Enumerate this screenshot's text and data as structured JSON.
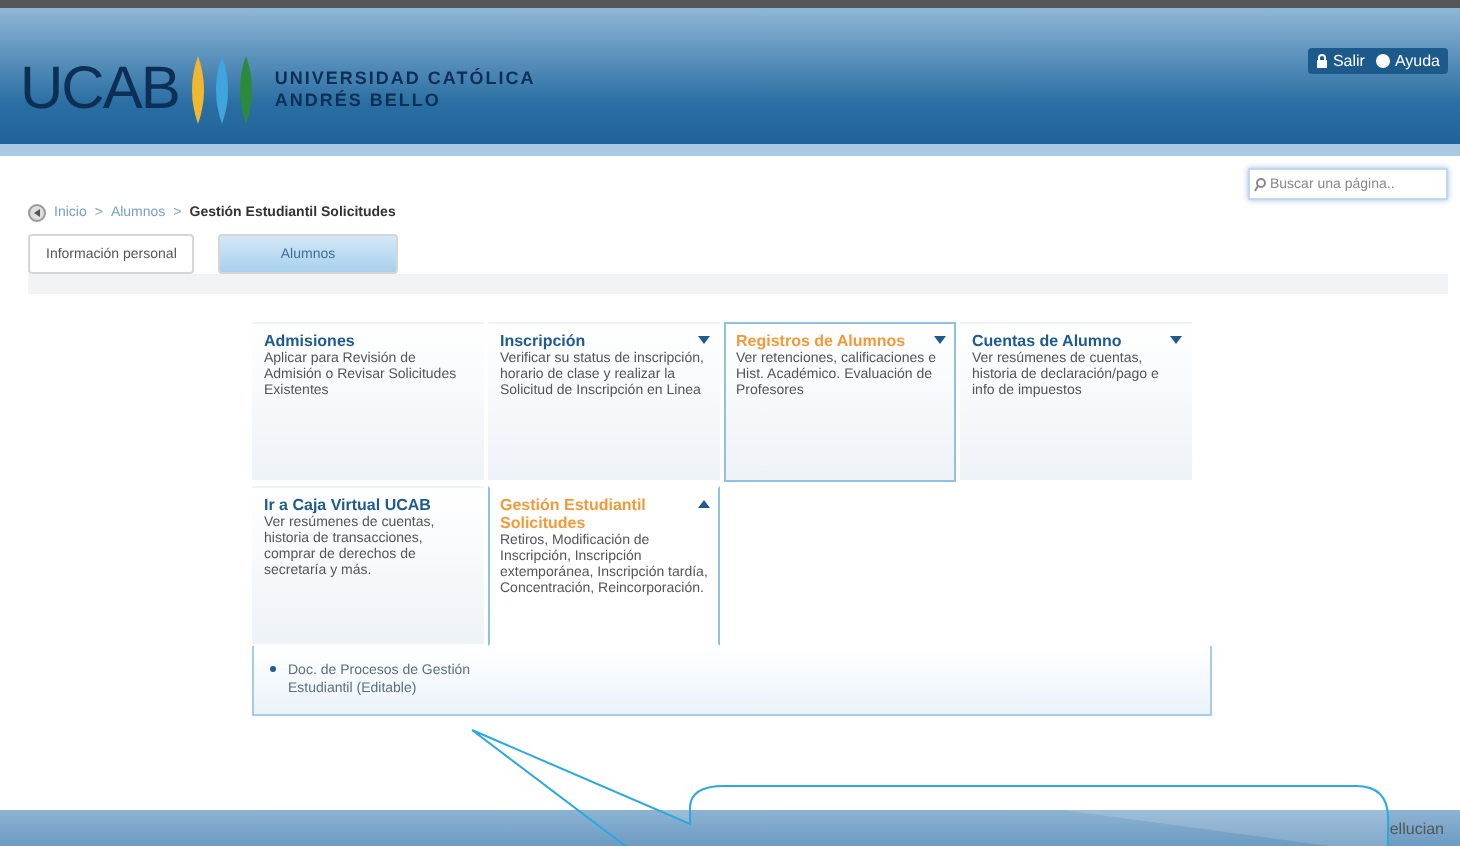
{
  "header": {
    "logo": "UCAB",
    "university_line_1": "UNIVERSIDAD CATÓLICA",
    "university_line_2": "ANDRÉS BELLO",
    "buttons": [
      "Salir",
      "Ayuda"
    ]
  },
  "search": {
    "placeholder": "Buscar una página.."
  },
  "breadcrumb": {
    "links": [
      "Inicio",
      "Alumnos"
    ],
    "separator": ">",
    "current": "Gestión Estudiantil Solicitudes"
  },
  "tabs": [
    {
      "label": "Información personal",
      "selected": false
    },
    {
      "label": "Alumnos",
      "selected": true
    }
  ],
  "tiles": [
    {
      "title": "Admisiones",
      "description": "Aplicar para Revisión de Admisión o Revisar Solicitudes Existentes",
      "kind": "link",
      "selected": false,
      "expanded": false
    },
    {
      "title": "Inscripción",
      "description": "Verificar su status de inscripción, horario de clase y realizar la Solicitud de Inscripción en Linea",
      "kind": "menu",
      "selected": false,
      "expanded": false
    },
    {
      "title": "Registros de Alumnos",
      "description": "Ver retenciones, calificaciones e Hist. Académico. Evaluación de Profesores",
      "kind": "menu",
      "selected": true,
      "expanded": false
    },
    {
      "title": "Cuentas de Alumno",
      "description": "Ver resúmenes de cuentas, historia de declaración/pago e info de impuestos",
      "kind": "menu",
      "selected": false,
      "expanded": false
    },
    {
      "title": "Ir a Caja Virtual UCAB",
      "description": "Ver resúmenes de cuentas, historia de transacciones, comprar de derechos de secretaría y más.",
      "kind": "link",
      "selected": false,
      "expanded": false
    },
    {
      "title": "Gestión Estudiantil Solicitudes",
      "description": "Retiros, Modificación de Inscripción, Inscripción extemporánea, Inscripción tardía, Concentración, Reincorporación.",
      "kind": "menu",
      "selected": true,
      "expanded": true
    }
  ],
  "submenu": [
    "Doc. de Procesos de Gestión Estudiantil (Editable)"
  ],
  "footer": {
    "brand": "ellucian"
  }
}
